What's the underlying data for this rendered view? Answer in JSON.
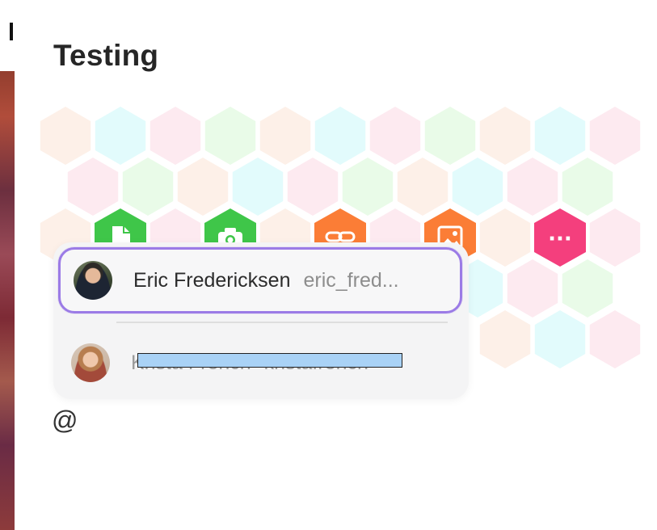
{
  "window": {
    "title": "Testing"
  },
  "colors": {
    "hex_peach": "#fdf0e8",
    "hex_cyan": "#e2fbfc",
    "hex_pink": "#fdeaf0",
    "hex_green": "#e9fbe8",
    "action_green": "#3fc649",
    "action_orange": "#fb7d36",
    "action_pink": "#f43f7d",
    "selected_border": "#9b7be6"
  },
  "actions": [
    {
      "name": "file-icon",
      "color": "action_green"
    },
    {
      "name": "camera-icon",
      "color": "action_green"
    },
    {
      "name": "link-icon",
      "color": "action_orange"
    },
    {
      "name": "image-icon",
      "color": "action_orange"
    },
    {
      "name": "more-icon",
      "color": "action_pink",
      "label": "···"
    }
  ],
  "mention_popup": {
    "options": [
      {
        "name": "Eric Fredericksen",
        "handle": "eric_fred...",
        "selected": true
      },
      {
        "name": "Krista French",
        "handle": "kristafrench",
        "selected": false,
        "redacted": true
      }
    ]
  },
  "composer": {
    "text": "@"
  }
}
